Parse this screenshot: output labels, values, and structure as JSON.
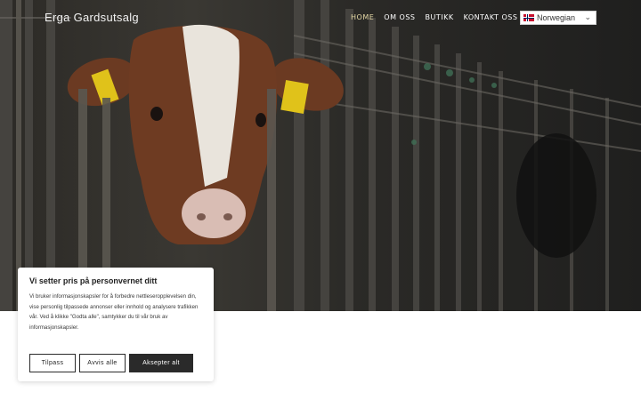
{
  "site": {
    "title": "Erga Gardsutsalg"
  },
  "nav": {
    "items": [
      {
        "label": "HOME"
      },
      {
        "label": "OM OSS"
      },
      {
        "label": "BUTIKK"
      },
      {
        "label": "KONTAKT OSS"
      }
    ]
  },
  "language": {
    "selected": "Norwegian",
    "flag_icon": "norway-flag-icon"
  },
  "cookie": {
    "title": "Vi setter pris på personvernet ditt",
    "body": "Vi bruker informasjonskapsler for å forbedre nettleseropplevelsen din, vise personlig tilpassede annonser eller innhold og analysere trafikken vår. Ved å klikke \"Godta alle\", samtykker du til vår bruk av informasjonskapsler.",
    "customize": "Tilpass",
    "reject": "Avvis alle",
    "accept": "Aksepter alt"
  },
  "colors": {
    "accent_nav": "#e6d9a6",
    "button_dark": "#2a2a2a"
  }
}
